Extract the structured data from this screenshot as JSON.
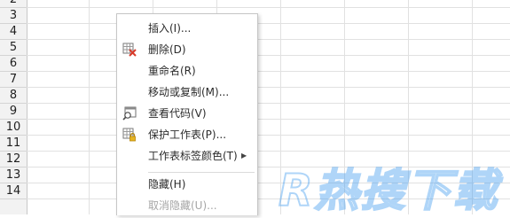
{
  "sheet": {
    "row_numbers": [
      "2",
      "3",
      "4",
      "5",
      "6",
      "7",
      "8",
      "9",
      "10",
      "11",
      "12",
      "13",
      "14"
    ]
  },
  "context_menu": {
    "items": [
      {
        "label": "插入(I)...",
        "icon": "",
        "disabled": false,
        "submenu": false
      },
      {
        "label": "删除(D)",
        "icon": "delete-sheet-icon",
        "disabled": false,
        "submenu": false
      },
      {
        "label": "重命名(R)",
        "icon": "",
        "disabled": false,
        "submenu": false
      },
      {
        "label": "移动或复制(M)...",
        "icon": "",
        "disabled": false,
        "submenu": false
      },
      {
        "label": "查看代码(V)",
        "icon": "view-code-icon",
        "disabled": false,
        "submenu": false
      },
      {
        "label": "保护工作表(P)...",
        "icon": "protect-sheet-icon",
        "disabled": false,
        "submenu": false
      },
      {
        "label": "工作表标签颜色(T)",
        "icon": "",
        "disabled": false,
        "submenu": true
      },
      {
        "label": "隐藏(H)",
        "icon": "",
        "disabled": false,
        "submenu": false
      },
      {
        "label": "取消隐藏(U)...",
        "icon": "",
        "disabled": true,
        "submenu": false
      }
    ]
  },
  "watermark": {
    "logo_text": "R热搜下载"
  },
  "colors": {
    "accent_red": "#d83b2b",
    "grid_line": "#e1e1e1",
    "watermark_blue": "#4fa3f0"
  }
}
